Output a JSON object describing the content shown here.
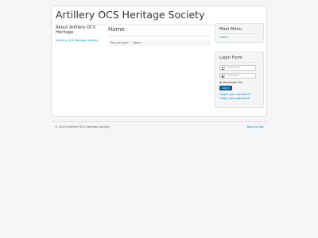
{
  "site": {
    "title": "Artillery OCS Heritage Society"
  },
  "left": {
    "about_title": "About Artillery OCS Heritage",
    "link": "Artillery OCS Heritage Society"
  },
  "main": {
    "page_title": "Home",
    "breadcrumb": {
      "label": "You are here:",
      "current": "Home"
    }
  },
  "main_menu": {
    "title": "Main Menu",
    "items": [
      {
        "label": "Home"
      }
    ]
  },
  "login": {
    "title": "Login Form",
    "username_placeholder": "Username",
    "password_placeholder": "Password",
    "remember": "Remember Me",
    "button": "Log in",
    "forgot_username": "Forgot your username?",
    "forgot_password": "Forgot your password?",
    "icons": [
      "user-icon",
      "lock-icon"
    ]
  },
  "footer": {
    "copyright": "© 2020 Artillery OCS Heritage Society",
    "back_to_top": "Back to Top"
  },
  "colors": {
    "link": "#0088cc",
    "button": "#005e8d",
    "page_bg": "#f4f6f7"
  }
}
